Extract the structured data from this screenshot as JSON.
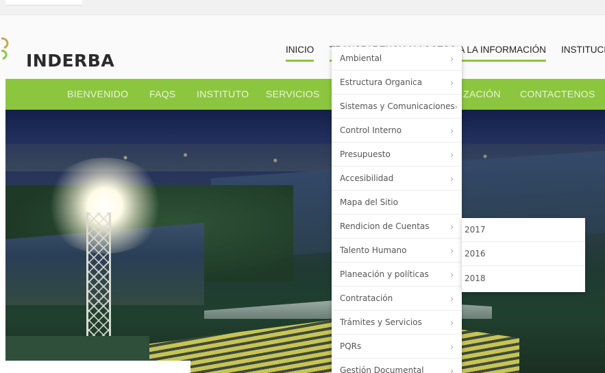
{
  "brand": {
    "name": "INDERBA",
    "accent_color": "#8cc63f"
  },
  "main_nav": {
    "inicio": "INICIO",
    "transparencia": "TRANSPARENCIA Y ACCESO A LA INFORMACIÓN",
    "institucional": "INSTITUCI"
  },
  "green_nav": {
    "bienvenido": "BIENVENIDO",
    "faqs": "FAQS",
    "instituto": "INSTITUTO",
    "servicios": "SERVICIOS",
    "actualizacion": "ZACIÓN",
    "contactenos": "CONTACTENOS"
  },
  "dropdown": {
    "items": [
      {
        "label": "Ambiental",
        "chevron": "›"
      },
      {
        "label": "Estructura Organica",
        "chevron": "›"
      },
      {
        "label": "Sistemas y Comunicaciones",
        "chevron": "›"
      },
      {
        "label": "Control Interno",
        "chevron": "›"
      },
      {
        "label": "Presupuesto",
        "chevron": "›"
      },
      {
        "label": "Accesibilidad",
        "chevron": "›"
      },
      {
        "label": "Mapa del Sitio",
        "chevron": ""
      },
      {
        "label": "Rendicion de Cuentas",
        "chevron": "›"
      },
      {
        "label": "Talento Humano",
        "chevron": "›"
      },
      {
        "label": "Planeación y políticas",
        "chevron": "›"
      },
      {
        "label": "Contratación",
        "chevron": "›"
      },
      {
        "label": "Trámites y Servicios",
        "chevron": "›"
      },
      {
        "label": "PQRs",
        "chevron": "›"
      },
      {
        "label": "Gestión Documental",
        "chevron": "›"
      }
    ]
  },
  "submenu": {
    "items": [
      {
        "label": "2017"
      },
      {
        "label": "2016"
      },
      {
        "label": "2018"
      }
    ]
  }
}
